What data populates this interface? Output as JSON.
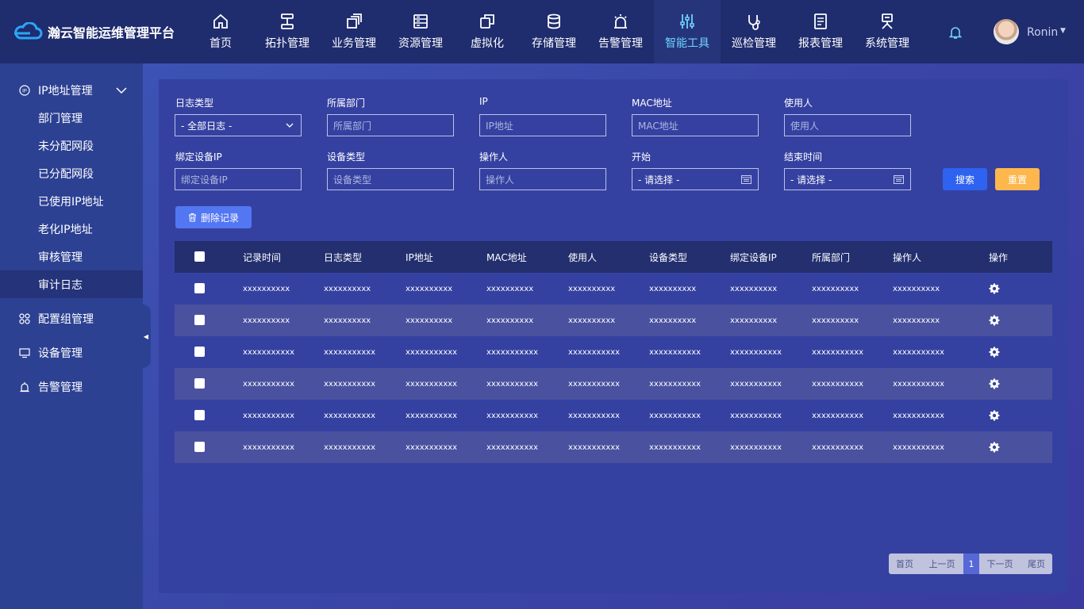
{
  "app": {
    "title": "瀚云智能运维管理平台"
  },
  "nav": [
    {
      "label": "首页",
      "icon": "home-icon"
    },
    {
      "label": "拓扑管理",
      "icon": "topology-icon"
    },
    {
      "label": "业务管理",
      "icon": "business-icon"
    },
    {
      "label": "资源管理",
      "icon": "resource-icon"
    },
    {
      "label": "虚拟化",
      "icon": "virtualization-icon"
    },
    {
      "label": "存储管理",
      "icon": "storage-icon"
    },
    {
      "label": "告警管理",
      "icon": "alarm-icon"
    },
    {
      "label": "智能工具",
      "icon": "tools-icon",
      "active": true
    },
    {
      "label": "巡检管理",
      "icon": "inspection-icon"
    },
    {
      "label": "报表管理",
      "icon": "report-icon"
    },
    {
      "label": "系统管理",
      "icon": "system-icon"
    }
  ],
  "user": {
    "name": "Ronin"
  },
  "sidebar": {
    "groups": [
      {
        "label": "IP地址管理",
        "icon": "ip-icon"
      },
      {
        "label": "配置组管理",
        "icon": "config-group-icon"
      },
      {
        "label": "设备管理",
        "icon": "device-icon"
      },
      {
        "label": "告警管理",
        "icon": "alarm-icon"
      }
    ],
    "subitems": [
      "部门管理",
      "未分配网段",
      "已分配网段",
      "已使用IP地址",
      "老化IP地址",
      "审核管理",
      "审计日志"
    ],
    "active_subitem": "审计日志"
  },
  "filters": {
    "log_type": {
      "label": "日志类型",
      "value": "- 全部日志 -"
    },
    "department": {
      "label": "所属部门",
      "placeholder": "所属部门"
    },
    "ip": {
      "label": "IP",
      "placeholder": "IP地址"
    },
    "mac": {
      "label": "MAC地址",
      "placeholder": "MAC地址"
    },
    "user": {
      "label": "使用人",
      "placeholder": "使用人"
    },
    "bound_ip": {
      "label": "绑定设备IP",
      "placeholder": "绑定设备IP"
    },
    "device_type": {
      "label": "设备类型",
      "placeholder": "设备类型"
    },
    "operator": {
      "label": "操作人",
      "placeholder": "操作人"
    },
    "start": {
      "label": "开始",
      "value": "- 请选择 -"
    },
    "end": {
      "label": "结束时间",
      "value": "- 请选择 -"
    }
  },
  "buttons": {
    "search": "搜索",
    "reset": "重置",
    "delete": "删除记录"
  },
  "table": {
    "headers": [
      "记录时间",
      "日志类型",
      "IP地址",
      "MAC地址",
      "使用人",
      "设备类型",
      "绑定设备IP",
      "所属部门",
      "操作人",
      "操作"
    ],
    "rows": [
      [
        "xxxxxxxxxx",
        "xxxxxxxxxx",
        "xxxxxxxxxx",
        "xxxxxxxxxx",
        "xxxxxxxxxx",
        "xxxxxxxxxx",
        "xxxxxxxxxx",
        "xxxxxxxxxx",
        "xxxxxxxxxx"
      ],
      [
        "xxxxxxxxxx",
        "xxxxxxxxxx",
        "xxxxxxxxxx",
        "xxxxxxxxxx",
        "xxxxxxxxxx",
        "xxxxxxxxxx",
        "xxxxxxxxxx",
        "xxxxxxxxxx",
        "xxxxxxxxxx"
      ],
      [
        "xxxxxxxxxxx",
        "xxxxxxxxxxx",
        "xxxxxxxxxxx",
        "xxxxxxxxxxx",
        "xxxxxxxxxxx",
        "xxxxxxxxxxx",
        "xxxxxxxxxxx",
        "xxxxxxxxxxx",
        "xxxxxxxxxxx"
      ],
      [
        "xxxxxxxxxxx",
        "xxxxxxxxxxx",
        "xxxxxxxxxxx",
        "xxxxxxxxxxx",
        "xxxxxxxxxxx",
        "xxxxxxxxxxx",
        "xxxxxxxxxxx",
        "xxxxxxxxxxx",
        "xxxxxxxxxxx"
      ],
      [
        "xxxxxxxxxxx",
        "xxxxxxxxxxx",
        "xxxxxxxxxxx",
        "xxxxxxxxxxx",
        "xxxxxxxxxxx",
        "xxxxxxxxxxx",
        "xxxxxxxxxxx",
        "xxxxxxxxxxx",
        "xxxxxxxxxxx"
      ],
      [
        "xxxxxxxxxxx",
        "xxxxxxxxxxx",
        "xxxxxxxxxxx",
        "xxxxxxxxxxx",
        "xxxxxxxxxxx",
        "xxxxxxxxxxx",
        "xxxxxxxxxxx",
        "xxxxxxxxxxx",
        "xxxxxxxxxxx"
      ]
    ]
  },
  "pagination": {
    "first": "首页",
    "prev": "上一页",
    "current": "1",
    "next": "下一页",
    "last": "尾页"
  },
  "colors": {
    "accent_active": "#6fd3ff",
    "search": "#2e62f0",
    "reset": "#fdb74d",
    "delete": "#5377f2"
  }
}
